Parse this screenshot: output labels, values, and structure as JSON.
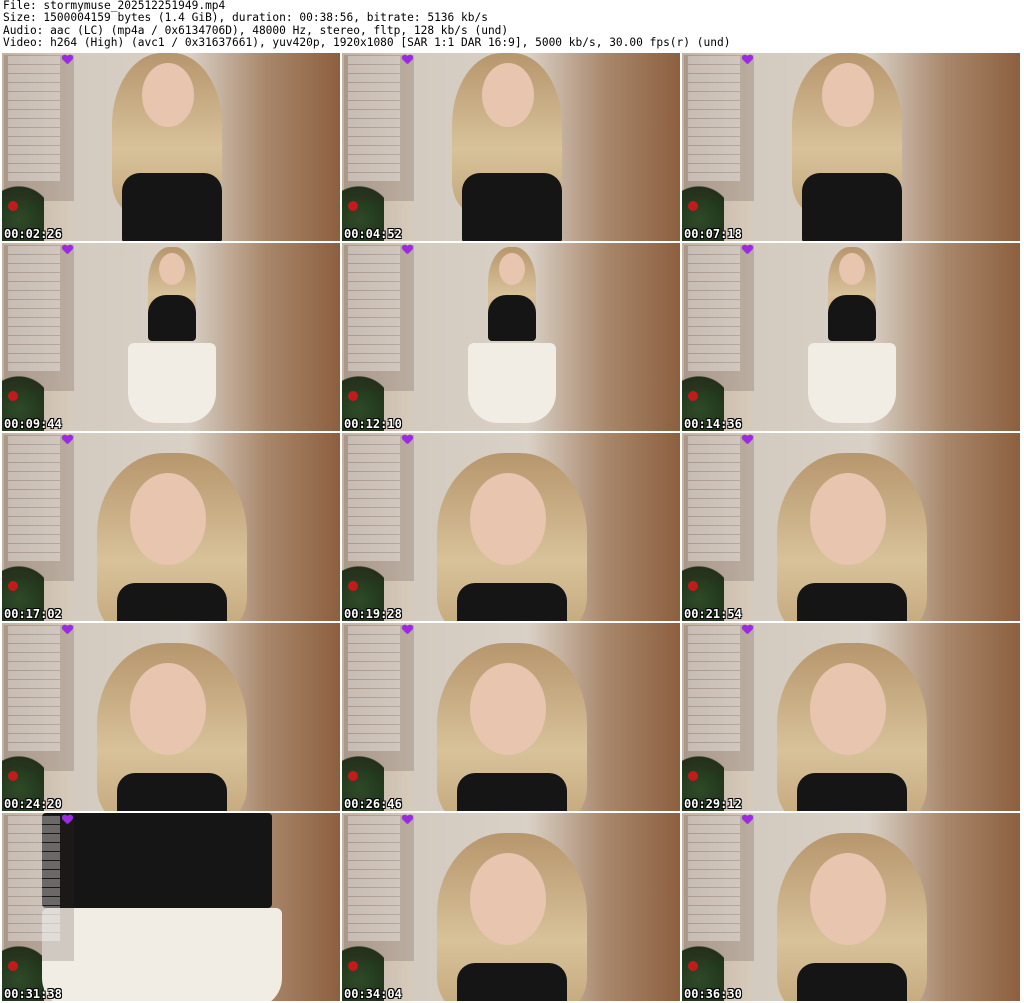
{
  "header": {
    "file": "File: stormymuse_202512251949.mp4",
    "size": "Size: 1500004159 bytes (1.4 GiB), duration: 00:38:56, bitrate: 5136 kb/s",
    "audio": "Audio: aac (LC) (mp4a / 0x6134706D), 48000 Hz, stereo, fltp, 128 kb/s (und)",
    "video": "Video: h264 (High) (avc1 / 0x31637661), yuv420p, 1920x1080 [SAR 1:1 DAR 16:9], 5000 kb/s, 30.00 fps(r) (und)"
  },
  "thumbnails": [
    {
      "timestamp": "00:02:26",
      "shot": "closeup"
    },
    {
      "timestamp": "00:04:52",
      "shot": "closeup"
    },
    {
      "timestamp": "00:07:18",
      "shot": "closeup"
    },
    {
      "timestamp": "00:09:44",
      "shot": "full"
    },
    {
      "timestamp": "00:12:10",
      "shot": "full"
    },
    {
      "timestamp": "00:14:36",
      "shot": "full"
    },
    {
      "timestamp": "00:17:02",
      "shot": "face"
    },
    {
      "timestamp": "00:19:28",
      "shot": "face"
    },
    {
      "timestamp": "00:21:54",
      "shot": "face"
    },
    {
      "timestamp": "00:24:20",
      "shot": "face"
    },
    {
      "timestamp": "00:26:46",
      "shot": "face"
    },
    {
      "timestamp": "00:29:12",
      "shot": "face"
    },
    {
      "timestamp": "00:31:38",
      "shot": "torso"
    },
    {
      "timestamp": "00:34:04",
      "shot": "face"
    },
    {
      "timestamp": "00:36:30",
      "shot": "face"
    }
  ]
}
